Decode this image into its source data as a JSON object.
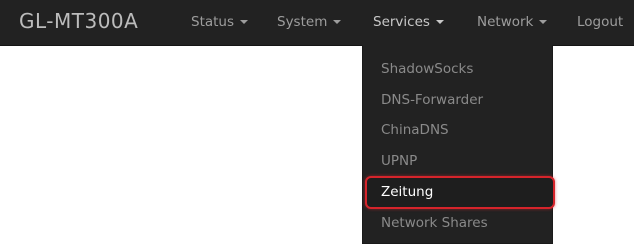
{
  "navbar": {
    "brand": "GL-MT300A",
    "items": [
      {
        "label": "Status"
      },
      {
        "label": "System"
      },
      {
        "label": "Services"
      },
      {
        "label": "Network"
      },
      {
        "label": "Logout"
      }
    ]
  },
  "services_menu": {
    "items": [
      {
        "label": "ShadowSocks"
      },
      {
        "label": "DNS-Forwarder"
      },
      {
        "label": "ChinaDNS"
      },
      {
        "label": "UPNP"
      },
      {
        "label": "Zeitung"
      },
      {
        "label": "Network Shares"
      }
    ],
    "highlighted_item": "Zeitung",
    "highlight_color": "#d6242b"
  }
}
